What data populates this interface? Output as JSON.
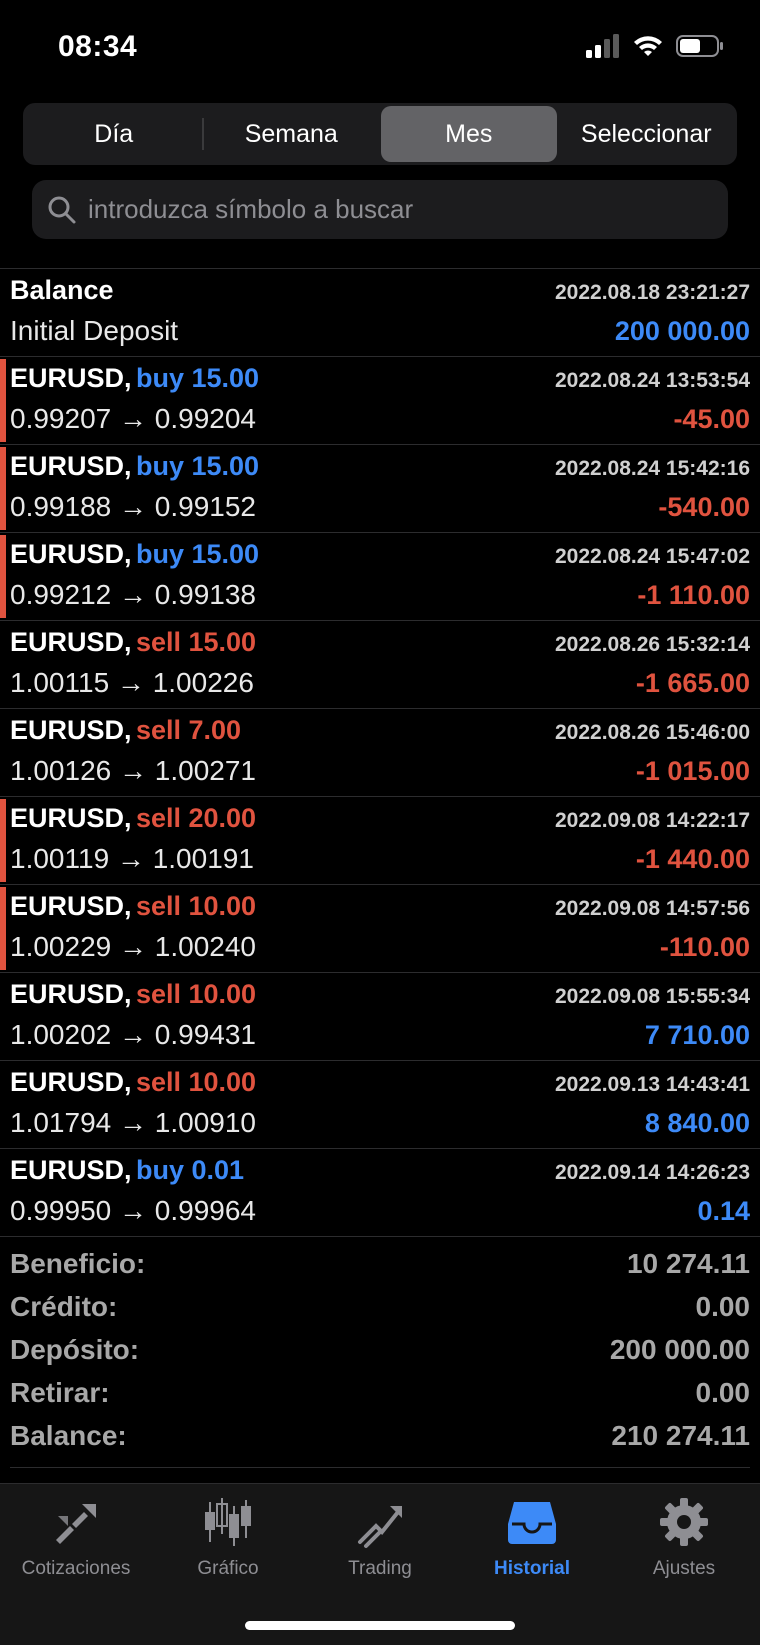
{
  "status": {
    "time": "08:34"
  },
  "segments": [
    "Día",
    "Semana",
    "Mes",
    "Seleccionar"
  ],
  "active_segment": "Mes",
  "search": {
    "placeholder": "introduzca símbolo a buscar"
  },
  "balance_row": {
    "title": "Balance",
    "date": "2022.08.18 23:21:27",
    "subtitle": "Initial Deposit",
    "amount": "200 000.00"
  },
  "deals": [
    {
      "symbol": "EURUSD,",
      "side": "buy 15.00",
      "type": "buy",
      "date": "2022.08.24 13:53:54",
      "prices": "0.99207 → 0.99204",
      "profit": "-45.00",
      "marked": true
    },
    {
      "symbol": "EURUSD,",
      "side": "buy 15.00",
      "type": "buy",
      "date": "2022.08.24 15:42:16",
      "prices": "0.99188 → 0.99152",
      "profit": "-540.00",
      "marked": true
    },
    {
      "symbol": "EURUSD,",
      "side": "buy 15.00",
      "type": "buy",
      "date": "2022.08.24 15:47:02",
      "prices": "0.99212 → 0.99138",
      "profit": "-1 110.00",
      "marked": true
    },
    {
      "symbol": "EURUSD,",
      "side": "sell 15.00",
      "type": "sell",
      "date": "2022.08.26 15:32:14",
      "prices": "1.00115 → 1.00226",
      "profit": "-1 665.00",
      "marked": false
    },
    {
      "symbol": "EURUSD,",
      "side": "sell 7.00",
      "type": "sell",
      "date": "2022.08.26 15:46:00",
      "prices": "1.00126 → 1.00271",
      "profit": "-1 015.00",
      "marked": false
    },
    {
      "symbol": "EURUSD,",
      "side": "sell 20.00",
      "type": "sell",
      "date": "2022.09.08 14:22:17",
      "prices": "1.00119 → 1.00191",
      "profit": "-1 440.00",
      "marked": true
    },
    {
      "symbol": "EURUSD,",
      "side": "sell 10.00",
      "type": "sell",
      "date": "2022.09.08 14:57:56",
      "prices": "1.00229 → 1.00240",
      "profit": "-110.00",
      "marked": true
    },
    {
      "symbol": "EURUSD,",
      "side": "sell 10.00",
      "type": "sell",
      "date": "2022.09.08 15:55:34",
      "prices": "1.00202 → 0.99431",
      "profit": "7 710.00",
      "marked": false
    },
    {
      "symbol": "EURUSD,",
      "side": "sell 10.00",
      "type": "sell",
      "date": "2022.09.13 14:43:41",
      "prices": "1.01794 → 1.00910",
      "profit": "8 840.00",
      "marked": false
    },
    {
      "symbol": "EURUSD,",
      "side": "buy 0.01",
      "type": "buy",
      "date": "2022.09.14 14:26:23",
      "prices": "0.99950 → 0.99964",
      "profit": "0.14",
      "marked": false
    }
  ],
  "summary": [
    {
      "label": "Beneficio:",
      "value": "10 274.11"
    },
    {
      "label": "Crédito:",
      "value": "0.00"
    },
    {
      "label": "Depósito:",
      "value": "200 000.00"
    },
    {
      "label": "Retirar:",
      "value": "0.00"
    },
    {
      "label": "Balance:",
      "value": "210 274.11"
    }
  ],
  "tabs": [
    {
      "label": "Cotizaciones",
      "icon": "quotes-icon"
    },
    {
      "label": "Gráfico",
      "icon": "chart-icon"
    },
    {
      "label": "Trading",
      "icon": "trading-icon"
    },
    {
      "label": "Historial",
      "icon": "history-icon"
    },
    {
      "label": "Ajustes",
      "icon": "settings-icon"
    }
  ],
  "active_tab": "Historial",
  "colors": {
    "buy": "#3d8af7",
    "sell": "#e0533f",
    "active_tab": "#3d8af7"
  }
}
